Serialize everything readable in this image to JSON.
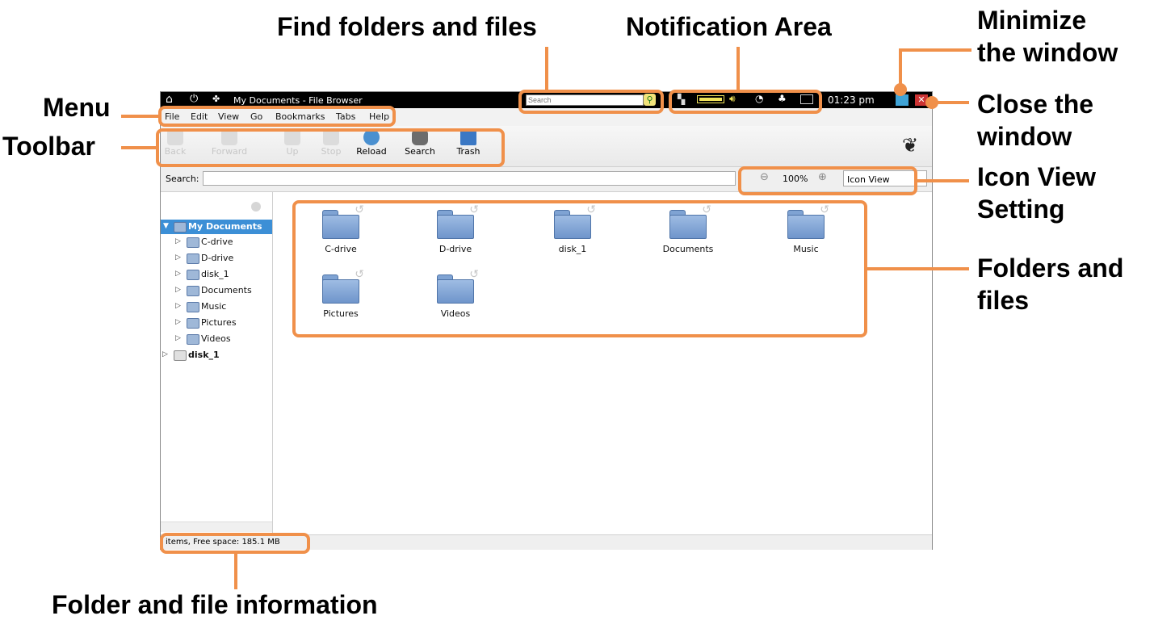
{
  "window": {
    "title": "My Documents - File Browser",
    "search_placeholder": "Search",
    "clock": "01:23 pm"
  },
  "menu": [
    "File",
    "Edit",
    "View",
    "Go",
    "Bookmarks",
    "Tabs",
    "Help"
  ],
  "toolbar": {
    "back_label": "Back",
    "forward_label": "Forward",
    "up_label": "Up",
    "stop_label": "Stop",
    "reload_label": "Reload",
    "search_label": "Search",
    "trash_label": "Trash"
  },
  "location": {
    "search_label": "Search:",
    "search_value": "",
    "zoom": "100%",
    "view_mode": "Icon View"
  },
  "sidebar": {
    "root": "My Documents",
    "items": [
      "C-drive",
      "D-drive",
      "disk_1",
      "Documents",
      "Music",
      "Pictures",
      "Videos"
    ],
    "other": "disk_1"
  },
  "folders": [
    "C-drive",
    "D-drive",
    "disk_1",
    "Documents",
    "Music",
    "Pictures",
    "Videos"
  ],
  "status": "items, Free space: 185.1 MB",
  "callouts": {
    "find": "Find folders and files",
    "notification": "Notification Area",
    "minimize_1": "Minimize",
    "minimize_2": "the window",
    "menu": "Menu",
    "toolbar": "Toolbar",
    "close_1": "Close the",
    "close_2": "window",
    "iconview_1": "Icon View",
    "iconview_2": "Setting",
    "folders_1": "Folders and",
    "folders_2": "files",
    "info": "Folder and file information"
  },
  "colors": {
    "accent": "#f0904a",
    "selection": "#3c8fd6"
  }
}
